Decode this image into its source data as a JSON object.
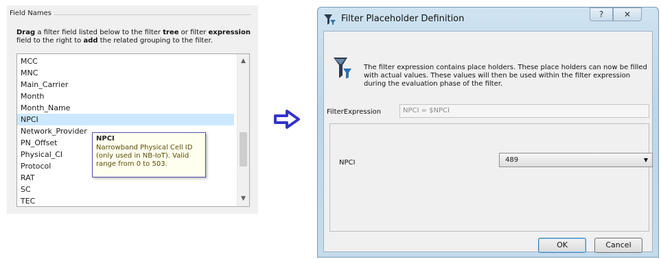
{
  "field_names_panel": {
    "group_title": "Field Names",
    "instructions": {
      "drag": "Drag",
      "part1": " a filter field listed below to the filter ",
      "tree": "tree",
      "part2": " or filter ",
      "expression": "expression",
      "part3": "field to the right to ",
      "add": "add",
      "part4": " the related grouping to the filter."
    },
    "items": [
      "MCC",
      "MNC",
      "Main_Carrier",
      "Month",
      "Month_Name",
      "NPCI",
      "Network_Provider",
      "PN_Offset",
      "Physical_CI",
      "Protocol",
      "RAT",
      "SC",
      "TEC"
    ],
    "selected_item": "NPCI",
    "scroll_up": "▲",
    "scroll_down": "▼",
    "tooltip": {
      "title": "NPCI",
      "line1": "Narrowband Physical Cell ID",
      "line2": "(only used in NB-IoT). Valid",
      "line3": "range from 0 to 503."
    }
  },
  "arrow": {
    "icon": "right-arrow-icon",
    "color": "#3333cc"
  },
  "dialog": {
    "title": "Filter Placeholder Definition",
    "help_symbol": "?",
    "close_symbol": "✕",
    "info_text": "The filter expression contains place holders. These place holders can now be filled with actual values. These values will then be used within the filter expression during the evaluation phase of the filter.",
    "filter_expression_label": "FilterExpression",
    "filter_expression_value": "NPCI = $NPCI",
    "parameter_label": "NPCI",
    "parameter_value": "489",
    "ok_label": "OK",
    "cancel_label": "Cancel"
  }
}
